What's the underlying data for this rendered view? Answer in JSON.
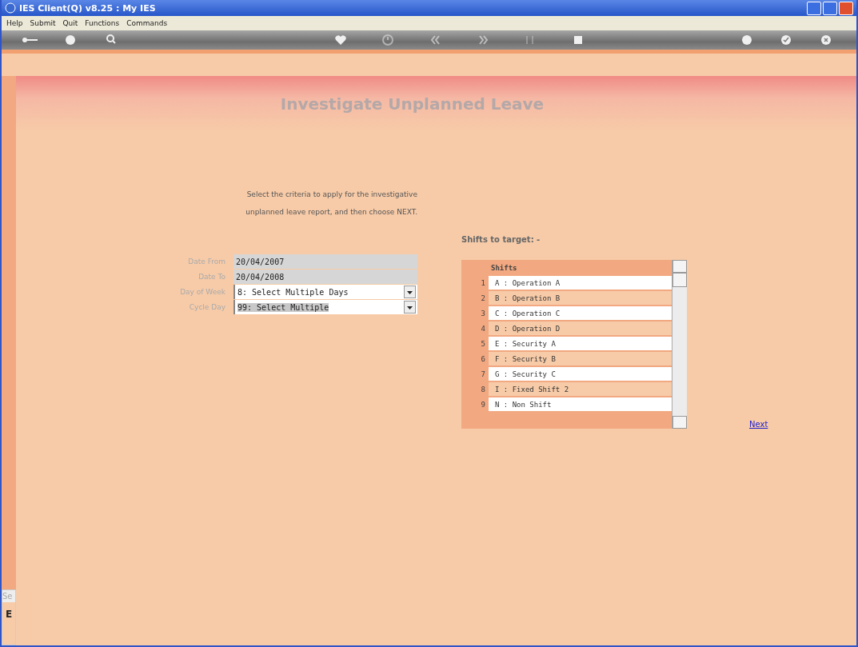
{
  "window": {
    "title": "IES Client(Q) v8.25 : My IES"
  },
  "menu": [
    "Help",
    "Submit",
    "Quit",
    "Functions",
    "Commands"
  ],
  "page_title": "Investigate Unplanned Leave",
  "instructions": "Select the criteria to apply for the investigative unplanned leave report, and then choose NEXT.",
  "fields": [
    {
      "label": "Date From",
      "value": "20/04/2007",
      "kind": "text",
      "highlighted": false
    },
    {
      "label": "Date To",
      "value": "20/04/2008",
      "kind": "text",
      "highlighted": false
    },
    {
      "label": "Day of Week",
      "value": "8: Select Multiple Days",
      "kind": "dropdown",
      "highlighted": false
    },
    {
      "label": "Cycle Day",
      "value": "99: Select Multiple",
      "kind": "dropdown",
      "highlighted": true
    }
  ],
  "shifts": {
    "heading": "Shifts to target: -",
    "column": "Shifts",
    "rows": [
      {
        "number": "1",
        "label": "A : Operation A"
      },
      {
        "number": "2",
        "label": "B : Operation B"
      },
      {
        "number": "3",
        "label": "C : Operation C"
      },
      {
        "number": "4",
        "label": "D : Operation D"
      },
      {
        "number": "5",
        "label": "E : Security A"
      },
      {
        "number": "6",
        "label": "F : Security B"
      },
      {
        "number": "7",
        "label": "G : Security C"
      },
      {
        "number": "8",
        "label": "I : Fixed Shift 2"
      },
      {
        "number": "9",
        "label": "N : Non Shift"
      }
    ]
  },
  "next_link": "Next",
  "side_panel": {
    "tab": "Se",
    "letter": "E"
  }
}
